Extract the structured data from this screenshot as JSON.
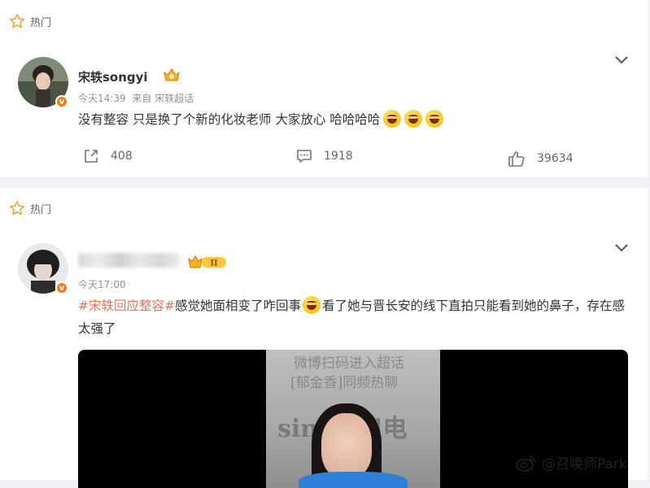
{
  "posts": [
    {
      "hot_label": "热门",
      "username": "宋轶songyi",
      "time": "今天14:39",
      "source": "来自 宋轶超话",
      "text": "没有整容 只是换了个新的化妆老师 大家放心 哈哈哈哈",
      "emojis": [
        "laughing-emoji",
        "laughing-emoji",
        "laughing-emoji"
      ],
      "repost_count": "408",
      "comment_count": "1918",
      "like_count": "39634"
    },
    {
      "hot_label": "热门",
      "username_blurred": true,
      "level_badge": "II",
      "time": "今天17:00",
      "hashtag": "#宋轶回应整容#",
      "text_part1": "感觉她面相变了咋回事",
      "text_part2": "看了她与晋长安的线下直拍只能看到她的鼻子，存在感太强了",
      "video_texts": [
        "微博扫码进入超话",
        "[郁金香]同频热聊",
        "sina新浪电"
      ]
    }
  ],
  "watermark": "@召唤师Park",
  "colors": {
    "accent": "#eb7350",
    "badge_orange": "#f37b1d",
    "meta_gray": "#939393"
  }
}
